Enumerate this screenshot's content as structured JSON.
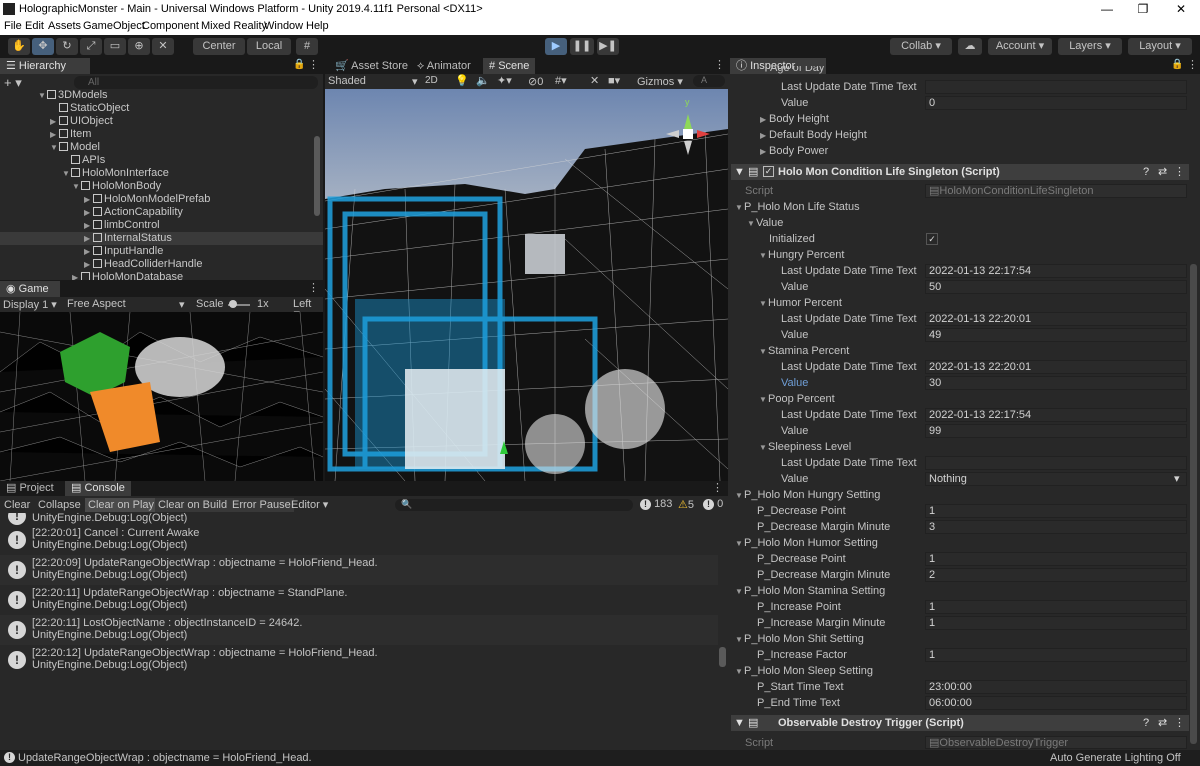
{
  "window": {
    "title": "HolographicMonster - Main - Universal Windows Platform - Unity 2019.4.11f1 Personal <DX11>",
    "minimize": "—",
    "restore": "❐",
    "close": "✕"
  },
  "menu": [
    "File",
    "Edit",
    "Assets",
    "GameObject",
    "Component",
    "Mixed Reality",
    "Window",
    "Help"
  ],
  "toolbar": {
    "center": "Center",
    "local": "Local",
    "collab": "Collab ▾",
    "account": "Account",
    "layers": "Layers",
    "layout": "Layout",
    "play_icon": "▶",
    "pause_icon": "❚❚",
    "step_icon": "▶❚"
  },
  "hierarchy": {
    "tab": "Hierarchy",
    "search_placeholder": "All",
    "rows": [
      {
        "label": "3DModels"
      },
      {
        "label": "StaticObject"
      },
      {
        "label": "UIObject"
      },
      {
        "label": "Item"
      },
      {
        "label": "Model"
      },
      {
        "label": "APIs"
      },
      {
        "label": "HoloMonInterface"
      },
      {
        "label": "HoloMonBody"
      },
      {
        "label": "HoloMonModelPrefab"
      },
      {
        "label": "ActionCapability"
      },
      {
        "label": "limbControl"
      },
      {
        "label": "InternalStatus"
      },
      {
        "label": "InputHandle"
      },
      {
        "label": "HeadColliderHandle"
      },
      {
        "label": "HoloMonDatabase"
      }
    ]
  },
  "game": {
    "tab": "Game",
    "display": "Display 1",
    "aspect": "Free Aspect",
    "scale_label": "Scale",
    "scale_value": "1x",
    "left_eye": "Left Ey"
  },
  "scene": {
    "tabs": [
      "Asset Store",
      "Animator",
      "Scene"
    ],
    "shading": "Shaded",
    "mode_2d": "2D",
    "hidden_count": "0",
    "gizmos": "Gizmos",
    "search": "A"
  },
  "console": {
    "tabs": [
      "Project",
      "Console"
    ],
    "buttons": [
      "Clear",
      "Collapse",
      "Clear on Play",
      "Clear on Build",
      "Error Pause",
      "Editor ▾"
    ],
    "count_log": "183",
    "count_warn": "5",
    "count_err": "0",
    "partial_line": "UnityEngine.Debug:Log(Object)",
    "rows": [
      {
        "l1": "[22:20:01] Cancel : Current Awake",
        "l2": "UnityEngine.Debug:Log(Object)"
      },
      {
        "l1": "[22:20:09] UpdateRangeObjectWrap : objectname = HoloFriend_Head.",
        "l2": "UnityEngine.Debug:Log(Object)"
      },
      {
        "l1": "[22:20:11] UpdateRangeObjectWrap : objectname = StandPlane.",
        "l2": "UnityEngine.Debug:Log(Object)"
      },
      {
        "l1": "[22:20:11] LostObjectName : objectInstanceID = 24642.",
        "l2": "UnityEngine.Debug:Log(Object)"
      },
      {
        "l1": "[22:20:12] UpdateRangeObjectWrap : objectname = HoloFriend_Head.",
        "l2": "UnityEngine.Debug:Log(Object)"
      }
    ]
  },
  "status_bar": {
    "message": "UpdateRangeObjectWrap : objectname = HoloFriend_Head.",
    "right": "Auto Generate Lighting Off"
  },
  "inspector": {
    "tab": "Inspector",
    "cutoff_top": "Age of Day",
    "top_rows": [
      {
        "label": "Last Update Date Time Text",
        "value": ""
      },
      {
        "label": "Value",
        "value": "0"
      },
      {
        "label": "Body Height",
        "value": null
      },
      {
        "label": "Default Body Height",
        "value": null
      },
      {
        "label": "Body Power",
        "value": null
      }
    ],
    "component1": {
      "title": "Holo Mon Condition Life Singleton (Script)",
      "script_label": "Script",
      "script_value": "HoloMonConditionLifeSingleton"
    },
    "rows": [
      {
        "label": "P_Holo Mon Life Status",
        "value": null
      },
      {
        "label": "Value",
        "value": null
      },
      {
        "label": "Initialized",
        "value": "✓"
      },
      {
        "label": "Hungry Percent",
        "value": null
      },
      {
        "label": "Last Update Date Time Text",
        "value": "2022-01-13 22:17:54"
      },
      {
        "label": "Value",
        "value": "50"
      },
      {
        "label": "Humor Percent",
        "value": null
      },
      {
        "label": "Last Update Date Time Text",
        "value": "2022-01-13 22:20:01"
      },
      {
        "label": "Value",
        "value": "49"
      },
      {
        "label": "Stamina Percent",
        "value": null
      },
      {
        "label": "Last Update Date Time Text",
        "value": "2022-01-13 22:20:01"
      },
      {
        "label": "Value",
        "value": "30"
      },
      {
        "label": "Poop Percent",
        "value": null
      },
      {
        "label": "Last Update Date Time Text",
        "value": "2022-01-13 22:17:54"
      },
      {
        "label": "Value",
        "value": "99"
      },
      {
        "label": "Sleepiness Level",
        "value": null
      },
      {
        "label": "Last Update Date Time Text",
        "value": ""
      },
      {
        "label": "Value",
        "value": "Nothing"
      },
      {
        "label": "P_Holo Mon Hungry Setting",
        "value": null
      },
      {
        "label": "P_Decrease Point",
        "value": "1"
      },
      {
        "label": "P_Decrease Margin Minute",
        "value": "3"
      },
      {
        "label": "P_Holo Mon Humor Setting",
        "value": null
      },
      {
        "label": "P_Decrease Point",
        "value": "1"
      },
      {
        "label": "P_Decrease Margin Minute",
        "value": "2"
      },
      {
        "label": "P_Holo Mon Stamina Setting",
        "value": null
      },
      {
        "label": "P_Increase Point",
        "value": "1"
      },
      {
        "label": "P_Increase Margin Minute",
        "value": "1"
      },
      {
        "label": "P_Holo Mon Shit Setting",
        "value": null
      },
      {
        "label": "P_Increase Factor",
        "value": "1"
      },
      {
        "label": "P_Holo Mon Sleep Setting",
        "value": null
      },
      {
        "label": "P_Start Time Text",
        "value": "23:00:00"
      },
      {
        "label": "P_End Time Text",
        "value": "06:00:00"
      }
    ],
    "component2": {
      "title": "Observable Destroy Trigger (Script)",
      "script_label": "Script",
      "script_value": "ObservableDestroyTrigger"
    }
  }
}
